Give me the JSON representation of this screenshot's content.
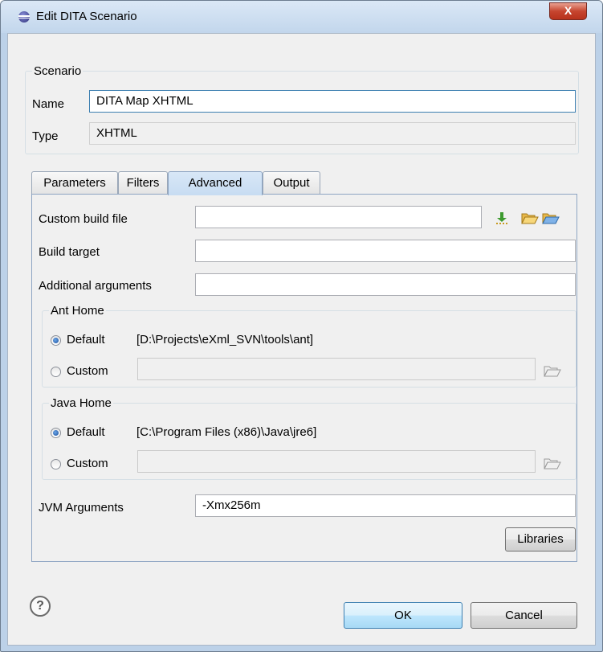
{
  "window": {
    "title": "Edit DITA Scenario",
    "close_glyph": "X"
  },
  "scenario": {
    "legend": "Scenario",
    "name_label": "Name",
    "name_value": "DITA Map XHTML",
    "type_label": "Type",
    "type_value": "XHTML"
  },
  "tabs": [
    {
      "label": "Parameters",
      "active": false
    },
    {
      "label": "Filters",
      "active": false
    },
    {
      "label": "Advanced",
      "active": true
    },
    {
      "label": "Output",
      "active": false
    }
  ],
  "advanced": {
    "custom_build_file_label": "Custom build file",
    "custom_build_file_value": "",
    "build_target_label": "Build target",
    "build_target_value": "",
    "additional_arguments_label": "Additional arguments",
    "additional_arguments_value": "",
    "ant_home": {
      "legend": "Ant Home",
      "default_label": "Default",
      "default_path": "[D:\\Projects\\eXml_SVN\\tools\\ant]",
      "custom_label": "Custom",
      "custom_value": "",
      "selected": "default"
    },
    "java_home": {
      "legend": "Java Home",
      "default_label": "Default",
      "default_path": "[C:\\Program Files (x86)\\Java\\jre6]",
      "custom_label": "Custom",
      "custom_value": "",
      "selected": "default"
    },
    "jvm_arguments_label": "JVM Arguments",
    "jvm_arguments_value": "-Xmx256m",
    "libraries_button": "Libraries"
  },
  "footer": {
    "ok_button": "OK",
    "cancel_button": "Cancel"
  },
  "icons": {
    "app": "eclipse-sphere-icon",
    "insert_editor_variables": "insert-variable-icon",
    "browse_local": "folder-open-icon",
    "browse_workspace": "folder-workspace-icon",
    "browse_disabled": "folder-disabled-icon",
    "help": "help-icon"
  },
  "colors": {
    "accent": "#3c7fb1",
    "tab_active": "#c7dcf2",
    "close": "#c6452f"
  }
}
